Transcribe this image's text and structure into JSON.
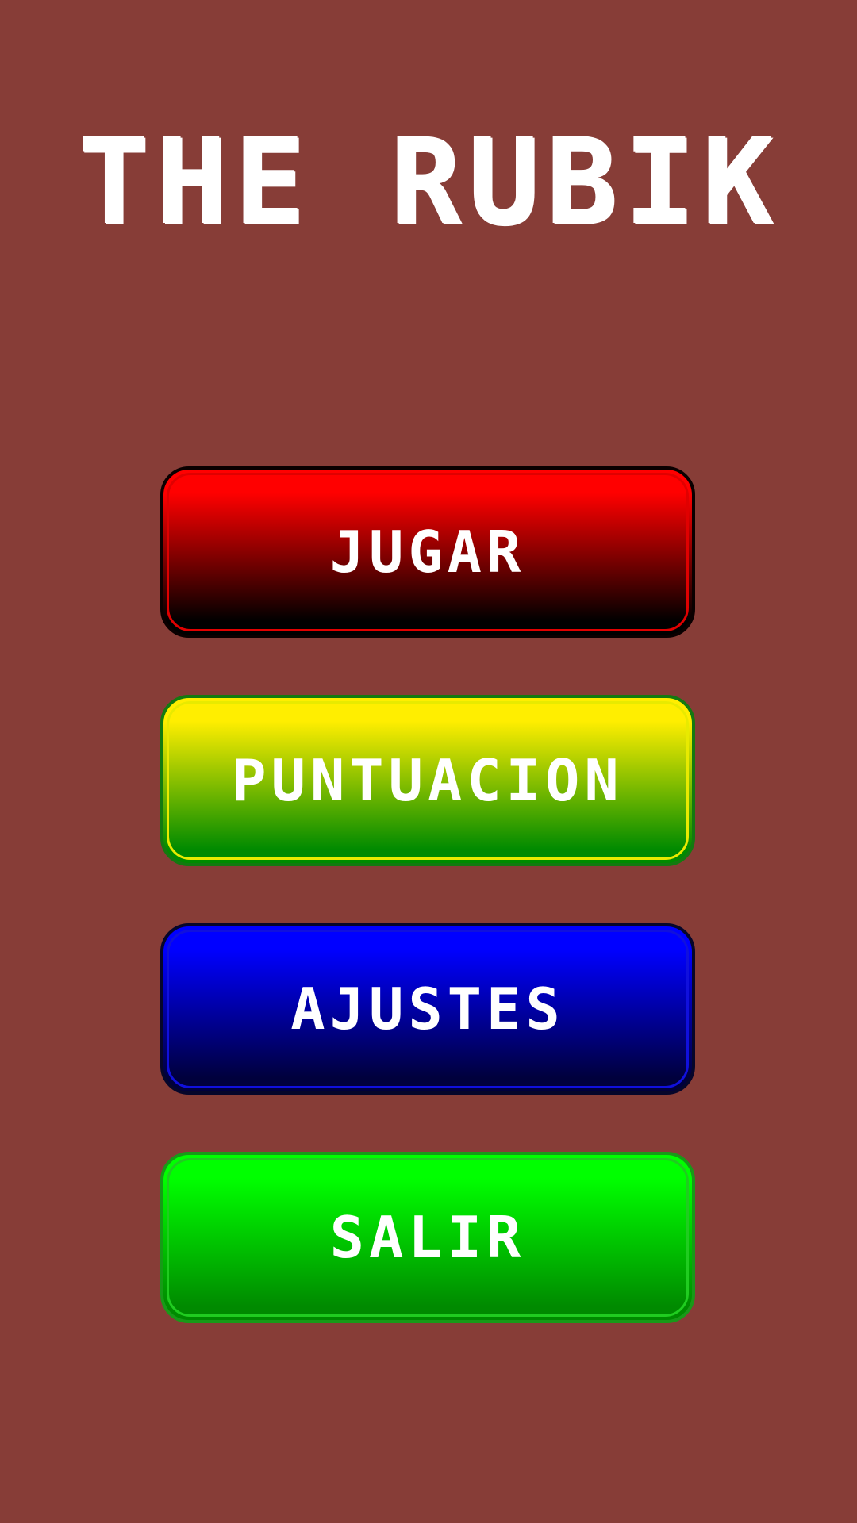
{
  "title": "THE RUBIK",
  "menu": {
    "play_label": "JUGAR",
    "score_label": "PUNTUACION",
    "settings_label": "AJUSTES",
    "exit_label": "SALIR"
  },
  "colors": {
    "background": "#873d37",
    "play": "#ff0000",
    "score": "#ffee00",
    "settings": "#0000ff",
    "exit": "#00ff00"
  }
}
